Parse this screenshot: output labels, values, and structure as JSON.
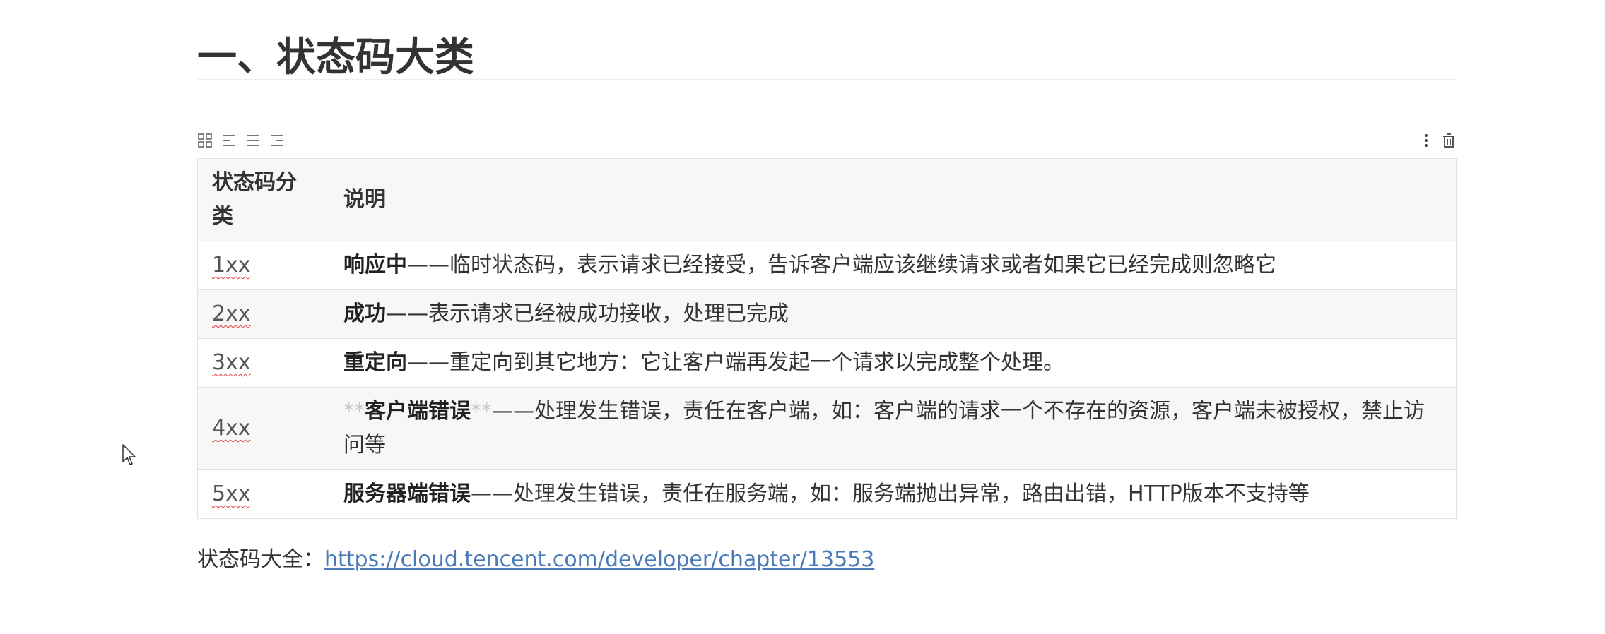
{
  "heading": "一、状态码大类",
  "table": {
    "headers": [
      "状态码分类",
      "说明"
    ],
    "rows": [
      {
        "code": "1xx",
        "prefix": "",
        "term": "响应中",
        "suffix": "",
        "desc": "——临时状态码，表示请求已经接受，告诉客户端应该继续请求或者如果它已经完成则忽略它"
      },
      {
        "code": "2xx",
        "prefix": "",
        "term": "成功",
        "suffix": "",
        "desc": "——表示请求已经被成功接收，处理已完成"
      },
      {
        "code": "3xx",
        "prefix": "",
        "term": "重定向",
        "suffix": "",
        "desc": "——重定向到其它地方：它让客户端再发起一个请求以完成整个处理。"
      },
      {
        "code": "4xx",
        "prefix": "**",
        "term": "客户端错误",
        "suffix": "**",
        "desc": "——处理发生错误，责任在客户端，如：客户端的请求一个不存在的资源，客户端未被授权，禁止访问等"
      },
      {
        "code": "5xx",
        "prefix": "",
        "term": "服务器端错误",
        "suffix": "",
        "desc": "——处理发生错误，责任在服务端，如：服务端抛出异常，路由出错，HTTP版本不支持等"
      }
    ]
  },
  "footer": {
    "label": "状态码大全：",
    "link": "https://cloud.tencent.com/developer/chapter/13553"
  },
  "toolbar_icons": [
    "grid-icon",
    "align-left-icon",
    "align-center-icon",
    "align-right-icon",
    "more-vertical-icon",
    "trash-icon"
  ]
}
